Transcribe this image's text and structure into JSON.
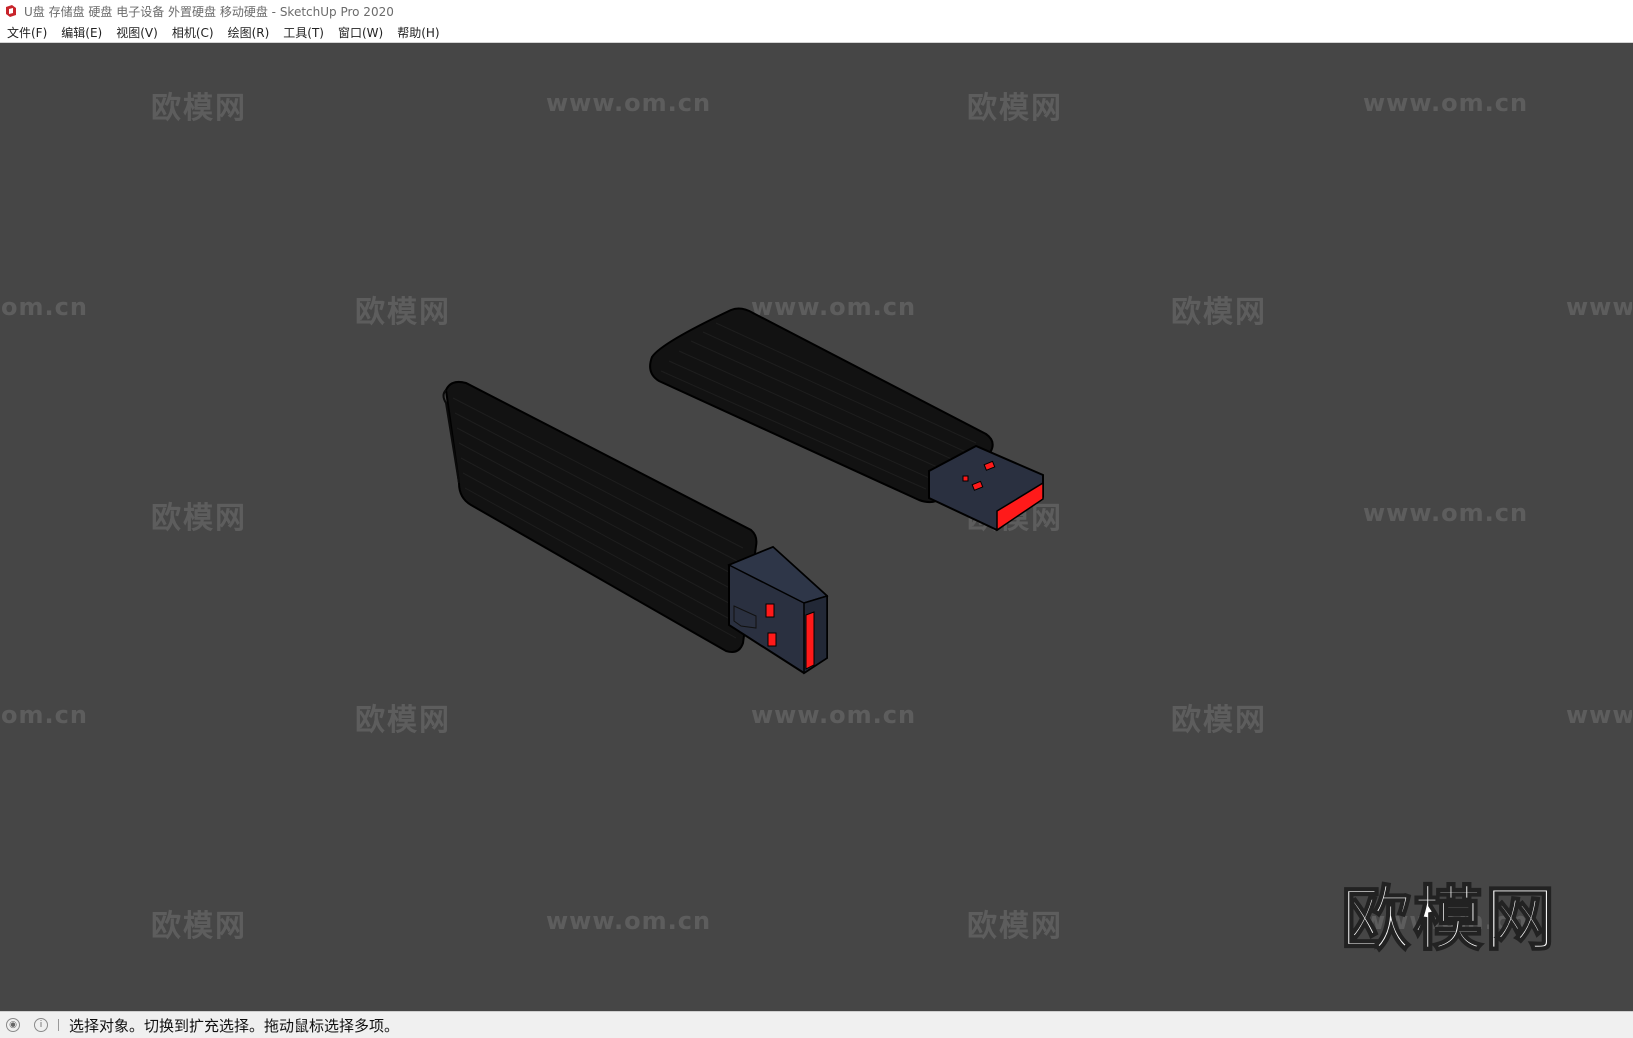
{
  "window": {
    "title": "U盘 存储盘 硬盘 电子设备 外置硬盘 移动硬盘 - SketchUp Pro 2020",
    "app_icon": "sketchup-icon",
    "brand_color": "#c8242b"
  },
  "menu": {
    "items": [
      {
        "label": "文件(F)"
      },
      {
        "label": "编辑(E)"
      },
      {
        "label": "视图(V)"
      },
      {
        "label": "相机(C)"
      },
      {
        "label": "绘图(R)"
      },
      {
        "label": "工具(T)"
      },
      {
        "label": "窗口(W)"
      },
      {
        "label": "帮助(H)"
      }
    ]
  },
  "viewport": {
    "background": "#464646",
    "watermarks": {
      "cn": "欧模网",
      "url": "www.om.cn",
      "url_partial_left": "om.cn",
      "url_partial_right": "www."
    },
    "logo": "欧模网",
    "model_colors": {
      "body": "#121212",
      "connector": "#2a3040",
      "accent": "#ff1a1a"
    }
  },
  "status": {
    "geo_icon": "geolocation-icon",
    "info_icon": "info-icon",
    "text": "选择对象。切换到扩充选择。拖动鼠标选择多项。"
  }
}
